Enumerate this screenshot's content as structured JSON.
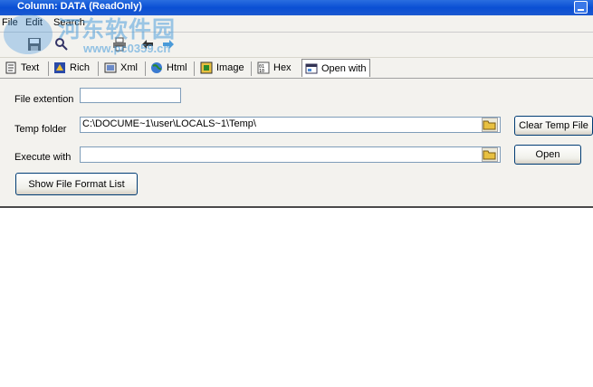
{
  "window": {
    "title": "Column: DATA  (ReadOnly)"
  },
  "menu": {
    "items": [
      "File",
      "Edit",
      "Search"
    ]
  },
  "watermark": {
    "text": "河东软件园",
    "url": "www.pc0359.cn"
  },
  "tabs": [
    {
      "label": "Text",
      "icon": "text-doc-icon"
    },
    {
      "label": "Rich",
      "icon": "rich-text-icon"
    },
    {
      "label": "Xml",
      "icon": "xml-icon"
    },
    {
      "label": "Html",
      "icon": "html-globe-icon"
    },
    {
      "label": "Image",
      "icon": "image-icon"
    },
    {
      "label": "Hex",
      "icon": "hex-icon"
    },
    {
      "label": "Open with",
      "icon": "open-with-icon",
      "active": true
    }
  ],
  "form": {
    "file_extension_label": "File extention",
    "file_extension_value": "",
    "temp_folder_label": "Temp folder",
    "temp_folder_value": "C:\\DOCUME~1\\user\\LOCALS~1\\Temp\\",
    "execute_with_label": "Execute with",
    "execute_with_value": "",
    "clear_temp_label": "Clear Temp File",
    "open_label": "Open",
    "show_formats_label": "Show File Format List"
  },
  "colors": {
    "titlebar": "#0a4fd4",
    "field_border": "#7f9db9",
    "button_border": "#003c74"
  }
}
